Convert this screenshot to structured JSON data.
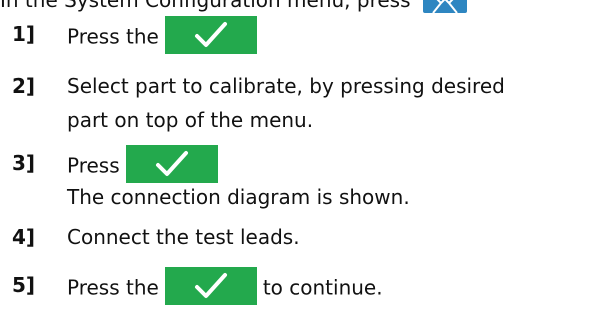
{
  "colors": {
    "check_button": "#23a94d",
    "config_icon": "#2e86c1",
    "text": "#111111"
  },
  "intro": {
    "text": "In the System Configuration menu, press",
    "icon": "tools-icon"
  },
  "steps": [
    {
      "number": "1]",
      "before": "Press the",
      "icon": "check-icon"
    },
    {
      "number": "2]",
      "line1": "Select part to calibrate, by pressing desired",
      "line2": "part on top of the menu."
    },
    {
      "number": "3]",
      "before": "Press",
      "icon": "check-icon",
      "line2": "The connection diagram is shown."
    },
    {
      "number": "4]",
      "line1": "Connect the test leads."
    },
    {
      "number": "5]",
      "before": "Press the",
      "icon": "check-icon",
      "after": "to continue."
    }
  ]
}
